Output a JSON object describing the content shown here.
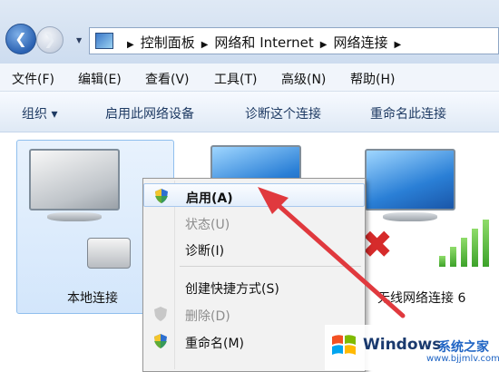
{
  "nav": {
    "back_icon": "back-arrow-icon",
    "forward_icon": "forward-arrow-icon",
    "breadcrumbs": [
      "控制面板",
      "网络和 Internet",
      "网络连接"
    ]
  },
  "menubar": {
    "items": [
      "文件(F)",
      "编辑(E)",
      "查看(V)",
      "工具(T)",
      "高级(N)",
      "帮助(H)"
    ]
  },
  "toolbar": {
    "organize": "组织 ▾",
    "enable_device": "启用此网络设备",
    "diagnose": "诊断这个连接",
    "rename": "重命名此连接"
  },
  "connections": [
    {
      "label": "本地连接",
      "state": "disabled",
      "icon": "wired-network-icon"
    },
    {
      "label": "",
      "state": "enabled",
      "icon": "network-monitor-icon"
    },
    {
      "label": "无线网络连接 6",
      "state": "disconnected",
      "icon": "wireless-network-icon"
    }
  ],
  "context_menu": {
    "items": [
      {
        "label": "启用(A)",
        "state": "highlighted",
        "icon": "uac-shield-icon"
      },
      {
        "label": "状态(U)",
        "state": "disabled"
      },
      {
        "label": "诊断(I)",
        "state": "normal"
      },
      {
        "label": "创建快捷方式(S)",
        "state": "normal"
      },
      {
        "label": "删除(D)",
        "state": "disabled",
        "icon": "uac-shield-icon"
      },
      {
        "label": "重命名(M)",
        "state": "normal",
        "icon": "uac-shield-icon"
      }
    ]
  },
  "watermark": {
    "brand": "Windows",
    "site": "系统之家",
    "url": "www.bjjmlv.com"
  },
  "colors": {
    "annotation_arrow": "#e0393e",
    "selection": "#d3e6fb",
    "accent": "#1f64c4"
  }
}
